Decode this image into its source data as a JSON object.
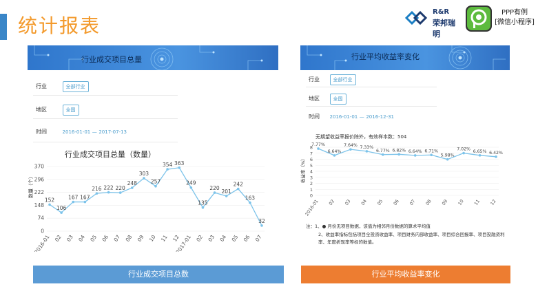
{
  "header": {
    "title": "统计报表",
    "logo_rr_line1": "R&R",
    "logo_rr_line2": "荣邦瑞明",
    "ppp_line1": "PPP有例",
    "ppp_line2": "[微信小程序]"
  },
  "left_panel": {
    "banner_title": "行业成交项目总量",
    "filters": [
      {
        "label": "行业",
        "value": "全部行业"
      },
      {
        "label": "地区",
        "value": "全国"
      }
    ],
    "time_label": "时间",
    "time_start": "2016-01-01",
    "time_dash": "—",
    "time_end": "2017-07-13",
    "chart_title": "行业成交项目总量（数量）",
    "ylabel": "数量（个）"
  },
  "right_panel": {
    "banner_title": "行业平均收益率变化",
    "filters": [
      {
        "label": "行业",
        "value": "全部行业"
      },
      {
        "label": "地区",
        "value": "全国"
      }
    ],
    "time_label": "时间",
    "time_start": "2016-01-01",
    "time_dash": "—",
    "time_end": "2016-12-31",
    "note_top": "无期望收益率报价除外，有效样本数：504",
    "ylabel": "收益率（%）",
    "notes": [
      "注：1、● 月份无项目数据，该值为相邻月份数据的算术平均值",
      "2、收益率指标包括项目全投资收益率、项目财务内部收益率、项目综合回报率、项目投融资利率、年度折现率等标的数值。"
    ]
  },
  "buttons": {
    "left": "行业成交项目总数",
    "right": "行业平均收益率变化"
  },
  "colors": {
    "accent": "#3a86c8",
    "title": "#f39a2c",
    "line": "#7cc3ea",
    "btn_left": "#5b9bd5",
    "btn_right": "#ed7d31"
  },
  "chart_data": [
    {
      "type": "line",
      "title": "行业成交项目总量（数量）",
      "ylabel": "数量（个）",
      "categories": [
        "2016-01",
        "02",
        "03",
        "04",
        "05",
        "06",
        "07",
        "08",
        "09",
        "10",
        "11",
        "12",
        "2017-01",
        "02",
        "03",
        "04",
        "05",
        "06",
        "07"
      ],
      "values": [
        152,
        106,
        167,
        167,
        216,
        222,
        220,
        248,
        303,
        257,
        354,
        363,
        249,
        135,
        220,
        201,
        242,
        163,
        32
      ],
      "yticks": [
        0,
        74,
        148,
        222,
        296,
        370
      ],
      "ylim": [
        0,
        370
      ]
    },
    {
      "type": "line",
      "ylabel": "收益率（%）",
      "categories": [
        "2016-01",
        "02",
        "03",
        "04",
        "05",
        "06",
        "07",
        "08",
        "09",
        "10",
        "11",
        "12"
      ],
      "values": [
        7.77,
        6.64,
        7.64,
        7.33,
        6.77,
        6.82,
        6.64,
        6.71,
        5.98,
        7.02,
        6.65,
        6.42
      ],
      "labels": [
        "7.77%",
        "6.64%",
        "7.64%",
        "7.33%",
        "6.77%",
        "6.82%",
        "6.64%",
        "6.71%",
        "5.98%",
        "7.02%",
        "6.65%",
        "6.42%"
      ],
      "yticks": [
        0,
        1,
        2,
        3,
        4,
        5,
        6,
        7,
        8
      ],
      "ylim": [
        0,
        8
      ]
    }
  ]
}
